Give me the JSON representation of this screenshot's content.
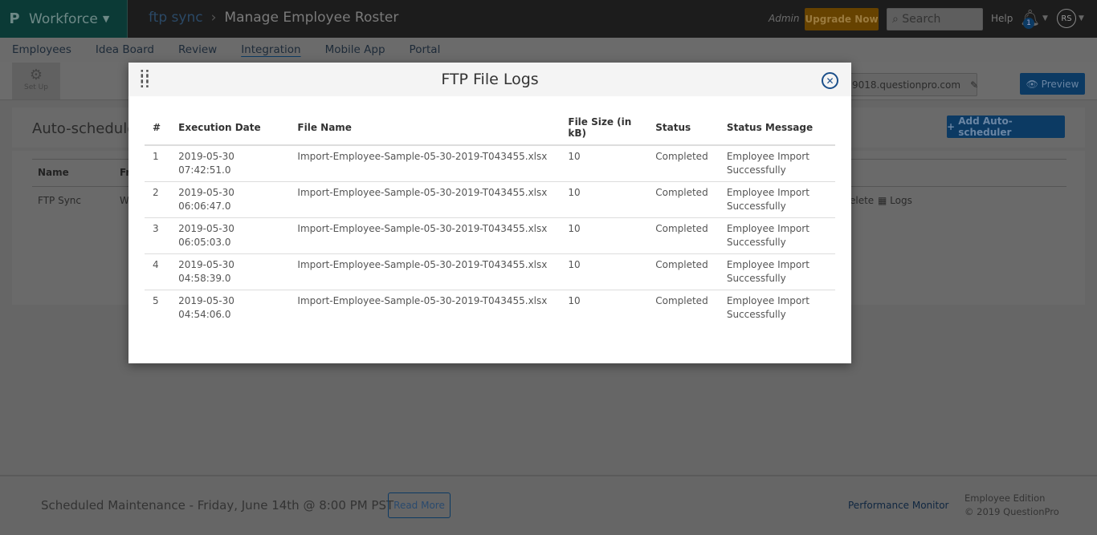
{
  "topbar": {
    "logo": "P",
    "product": "Workforce",
    "breadcrumb_parent": "ftp sync",
    "breadcrumb_current": "Manage Employee Roster",
    "role": "Admin",
    "upgrade": "Upgrade Now",
    "search_placeholder": "Search",
    "help": "Help",
    "notifications": "1",
    "avatar": "RS"
  },
  "nav": [
    "Employees",
    "Idea Board",
    "Review",
    "Integration",
    "Mobile App",
    "Portal"
  ],
  "setup": "Set Up",
  "url": "9018.questionpro.com",
  "preview": "Preview",
  "scheduler": {
    "title": "Auto-scheduler",
    "add": "Add Auto-scheduler",
    "col_name": "Name",
    "col_fr": "Fr",
    "row_name": "FTP Sync",
    "row_fr": "W",
    "actions": "elete",
    "logs": "Logs"
  },
  "modal": {
    "title": "FTP File Logs",
    "headers": [
      "#",
      "Execution Date",
      "File Name",
      "File Size (in kB)",
      "Status",
      "Status Message"
    ],
    "rows": [
      [
        "1",
        "2019-05-30 07:42:51.0",
        "Import-Employee-Sample-05-30-2019-T043455.xlsx",
        "10",
        "Completed",
        "Employee Import Successfully"
      ],
      [
        "2",
        "2019-05-30 06:06:47.0",
        "Import-Employee-Sample-05-30-2019-T043455.xlsx",
        "10",
        "Completed",
        "Employee Import Successfully"
      ],
      [
        "3",
        "2019-05-30 06:05:03.0",
        "Import-Employee-Sample-05-30-2019-T043455.xlsx",
        "10",
        "Completed",
        "Employee Import Successfully"
      ],
      [
        "4",
        "2019-05-30 04:58:39.0",
        "Import-Employee-Sample-05-30-2019-T043455.xlsx",
        "10",
        "Completed",
        "Employee Import Successfully"
      ],
      [
        "5",
        "2019-05-30 04:54:06.0",
        "Import-Employee-Sample-05-30-2019-T043455.xlsx",
        "10",
        "Completed",
        "Employee Import Successfully"
      ]
    ]
  },
  "footer": {
    "maintenance": "Scheduled Maintenance - Friday, June 14th @ 8:00 PM PST",
    "read_more": "Read More",
    "perf": "Performance Monitor",
    "edition": "Employee Edition",
    "copyright": "© 2019 QuestionPro"
  }
}
